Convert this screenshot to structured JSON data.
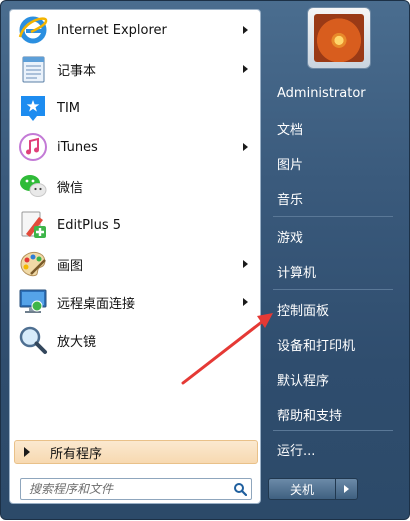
{
  "programs": [
    {
      "label": "Internet Explorer",
      "icon": "internet-explorer-icon",
      "has_submenu": true
    },
    {
      "label": "记事本",
      "icon": "notepad-icon",
      "has_submenu": true
    },
    {
      "label": "TIM",
      "icon": "tim-icon",
      "has_submenu": false
    },
    {
      "label": "iTunes",
      "icon": "itunes-icon",
      "has_submenu": true
    },
    {
      "label": "微信",
      "icon": "wechat-icon",
      "has_submenu": false
    },
    {
      "label": "EditPlus 5",
      "icon": "editplus-icon",
      "has_submenu": false
    },
    {
      "label": "画图",
      "icon": "paint-icon",
      "has_submenu": true
    },
    {
      "label": "远程桌面连接",
      "icon": "remote-desktop-icon",
      "has_submenu": true
    },
    {
      "label": "放大镜",
      "icon": "magnifier-icon",
      "has_submenu": false
    }
  ],
  "all_programs": {
    "label": "所有程序"
  },
  "search": {
    "placeholder": "搜索程序和文件"
  },
  "right": {
    "user": "Administrator",
    "items": [
      "文档",
      "图片",
      "音乐",
      "游戏",
      "计算机",
      "控制面板",
      "设备和打印机",
      "默认程序",
      "帮助和支持",
      "运行..."
    ]
  },
  "shutdown": {
    "label": "关机"
  },
  "colors": {
    "annotation_arrow": "#e53935",
    "accent": "#f7d9b1"
  }
}
